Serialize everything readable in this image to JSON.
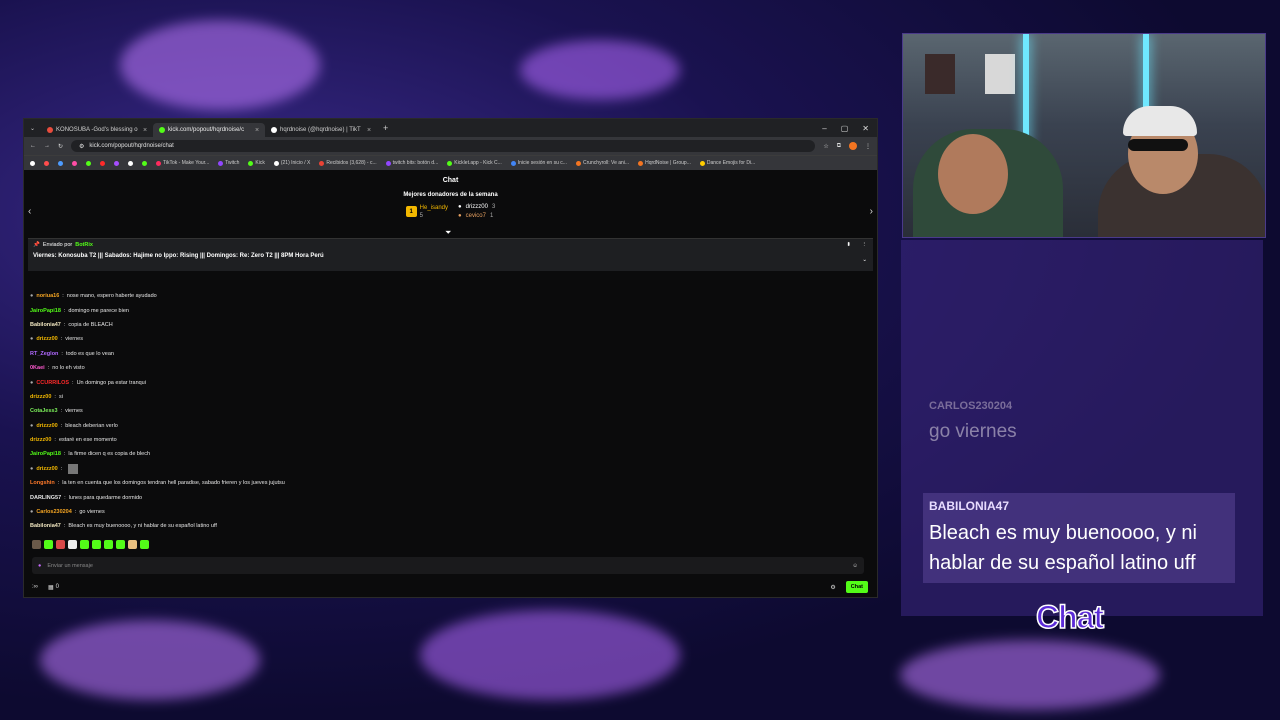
{
  "browser": {
    "tabs": [
      {
        "label": "KONOSUBA -God's blessing o",
        "color": "#e84c3d"
      },
      {
        "label": "kick.com/popout/hqrdnoise/c",
        "color": "#53fc18"
      },
      {
        "label": "hqrdnoise (@hqrdnoise) | TikT",
        "color": "#ffffff"
      }
    ],
    "url": "kick.com/popout/hqrdnoise/chat",
    "bookmarks": [
      {
        "label": "TikTok - Make Your...",
        "color": "#ff2a5e"
      },
      {
        "label": "Twitch",
        "color": "#9146ff"
      },
      {
        "label": "Kick",
        "color": "#53fc18"
      },
      {
        "label": "(21) Inicio / X",
        "color": "#ffffff"
      },
      {
        "label": "Recibidos (3,628) - c...",
        "color": "#ea4335"
      },
      {
        "label": "twitch bits: botón d...",
        "color": "#9146ff"
      },
      {
        "label": "Kicklet.app - Kick C...",
        "color": "#53fc18"
      },
      {
        "label": "Inicie sesión en su c...",
        "color": "#4285f4"
      },
      {
        "label": "Crunchyroll: Ve ani...",
        "color": "#f47521"
      },
      {
        "label": "HqrdNoise | Group...",
        "color": "#f47521"
      },
      {
        "label": "Dance Emojis for Di...",
        "color": "#ffcc00"
      }
    ]
  },
  "chat": {
    "title": "Chat",
    "donors_title": "Mejores donadores de la semana",
    "donors": [
      {
        "name": "He_isandy",
        "amount": "5",
        "color": "#f3b800"
      },
      {
        "name": "drizzz00",
        "amount": "3",
        "color": "#e6e6e6"
      },
      {
        "name": "cevico7",
        "amount": "1",
        "color": "#e6a060"
      }
    ],
    "pinned_by": "Enviado por",
    "pinned_user": "BotRix",
    "pinned_text": "Viernes: Konosuba T2 ||| Sabados: Hajime no Ippo: Rising ||| Domingos: Re: Zero T2 ||| 8PM Hora Perú",
    "messages": [
      {
        "user": "noriua16",
        "text": "nose mano, espero haberte ayudado",
        "color": "#f6a623"
      },
      {
        "user": "JairoPapi18",
        "text": "domingo me parece bien",
        "color": "#53fc18"
      },
      {
        "user": "Babilonia47",
        "text": "copia de BLEACH",
        "color": "#f0e6c0"
      },
      {
        "user": "drizzz00",
        "text": "viernes",
        "color": "#f3b800"
      },
      {
        "user": "RT_Zeglon",
        "text": "todo es que lo vean",
        "color": "#b069ff"
      },
      {
        "user": "0Kaei",
        "text": "no lo eh visto",
        "color": "#ff5ad0"
      },
      {
        "user": "CCURRILOS",
        "text": "Un domingo pa estar tranqui",
        "color": "#ff2a2a"
      },
      {
        "user": "drizzz00",
        "text": "si",
        "color": "#f3b800"
      },
      {
        "user": "CotaJess3",
        "text": "viernes",
        "color": "#7cf05a"
      },
      {
        "user": "drizzz00",
        "text": "bleach deberian verlo",
        "color": "#f3b800"
      },
      {
        "user": "drizzz00",
        "text": "estaré en ese momento",
        "color": "#f3b800"
      },
      {
        "user": "JairoPapi18",
        "text": "la firme dicen q es copia de blech",
        "color": "#53fc18"
      },
      {
        "user": "drizzz00",
        "text": "",
        "color": "#f3b800"
      },
      {
        "user": "Longshin",
        "text": "la ten en cuenta que los domingos tendran hell paradise, sabado frieren y los jueves jujutsu",
        "color": "#ff7a2a"
      },
      {
        "user": "DARLING57",
        "text": "lunes para quedarme dormido",
        "color": "#e6e6e6"
      },
      {
        "user": "Carlos230204",
        "text": "go viernes",
        "color": "#f6a623"
      },
      {
        "user": "Babilonia47",
        "text": "Bleach es muy buenoooo, y ni hablar de su español latino uff",
        "color": "#f0e6c0"
      }
    ],
    "input_placeholder": "Enviar un mensaje",
    "footer_left": ":∞",
    "footer_count": "0",
    "send_label": "Chat",
    "send_color": "#53fc18"
  },
  "overlay": {
    "ghost_user": "CARLOS230204",
    "ghost_msg": "go viernes",
    "card_user": "BABILONIA47",
    "card_msg": "Bleach es muy buenoooo, y ni hablar de su español latino uff",
    "logo": "Chat"
  }
}
